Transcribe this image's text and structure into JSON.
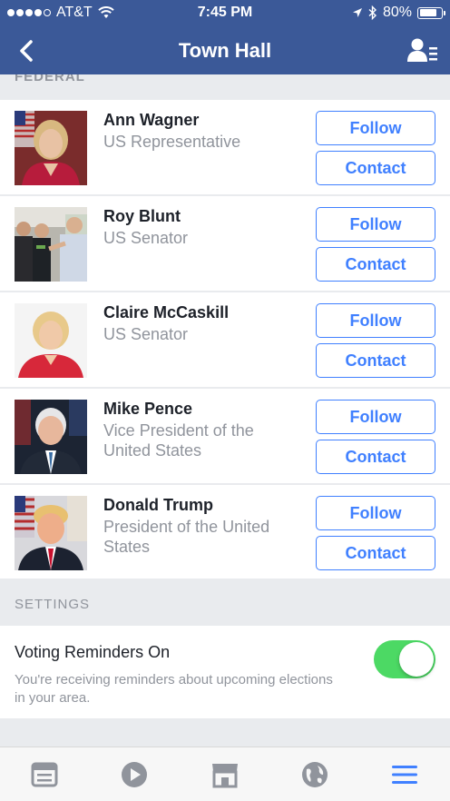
{
  "status_bar": {
    "carrier": "AT&T",
    "time": "7:45 PM",
    "battery": "80%",
    "battery_level": 0.8
  },
  "nav": {
    "title": "Town Hall",
    "back_icon": "chevron-left-icon",
    "right_icon": "contacts-list-icon"
  },
  "section_peek": "FEDERAL",
  "representatives": [
    {
      "name": "Ann Wagner",
      "title": "US Representative",
      "follow_label": "Follow",
      "contact_label": "Contact"
    },
    {
      "name": "Roy Blunt",
      "title": "US Senator",
      "follow_label": "Follow",
      "contact_label": "Contact"
    },
    {
      "name": "Claire McCaskill",
      "title": "US Senator",
      "follow_label": "Follow",
      "contact_label": "Contact"
    },
    {
      "name": "Mike Pence",
      "title": "Vice President of the United States",
      "follow_label": "Follow",
      "contact_label": "Contact"
    },
    {
      "name": "Donald Trump",
      "title": "President of the United States",
      "follow_label": "Follow",
      "contact_label": "Contact"
    }
  ],
  "settings": {
    "header": "SETTINGS",
    "voting_reminders": {
      "label": "Voting Reminders On",
      "description": "You're receiving reminders about upcoming elections in your area.",
      "enabled": true
    }
  },
  "tab_bar": [
    {
      "name": "news-feed-icon"
    },
    {
      "name": "video-icon"
    },
    {
      "name": "marketplace-icon"
    },
    {
      "name": "globe-icon"
    },
    {
      "name": "menu-icon"
    }
  ],
  "colors": {
    "brand": "#3b5998",
    "accent": "#4080ff",
    "toggle_on": "#4cd964",
    "muted": "#90949c"
  }
}
